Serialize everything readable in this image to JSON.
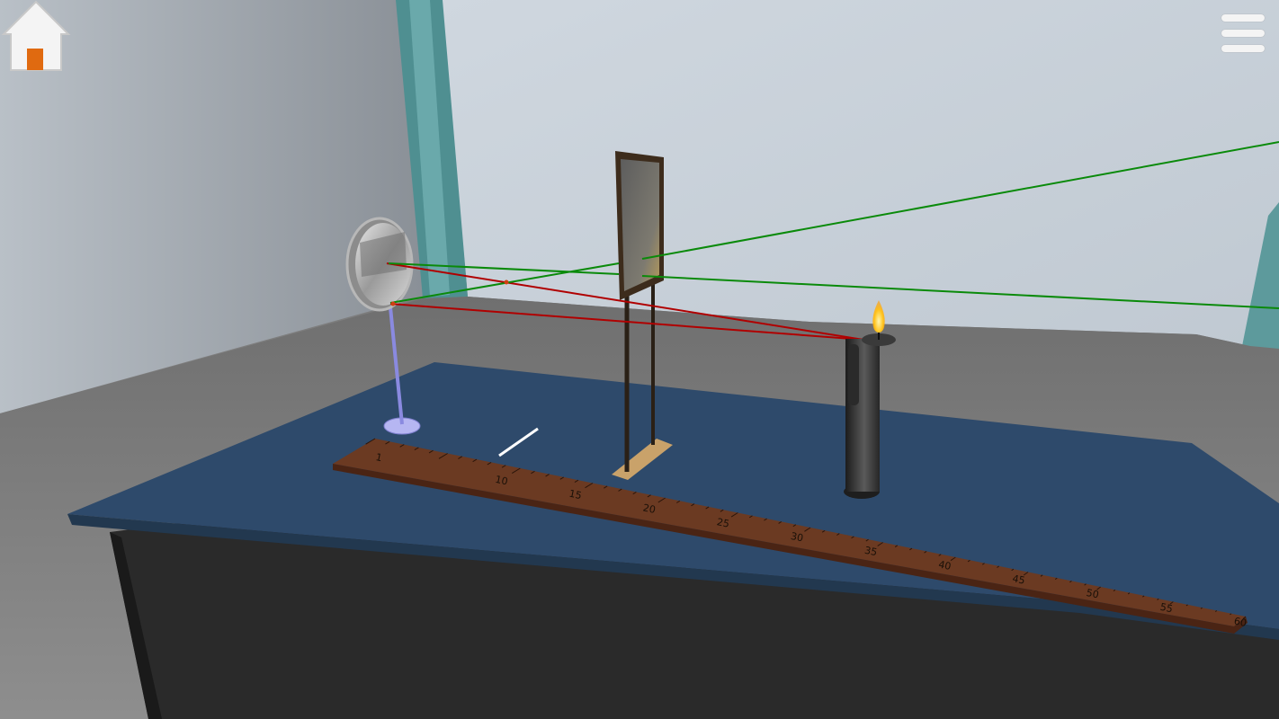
{
  "toolbar": {
    "home_icon": "home-icon",
    "menu_icon": "hamburger-menu-icon"
  },
  "ruler": {
    "tick_labels": [
      "1",
      "10",
      "15",
      "20",
      "25",
      "30",
      "35",
      "40",
      "45",
      "50",
      "55",
      "60"
    ]
  },
  "labels": {
    "object_marker": "",
    "screen_marker": ""
  },
  "colors": {
    "wall_left": "#9aa0a6",
    "wall_back": "#c7d0d8",
    "floor": "#7a7a7a",
    "table_top": "#2e4a6b",
    "ruler": "#6b3a22",
    "ray_red": "#b00000",
    "ray_green": "#0a8a0a",
    "mirror_stand": "#8080e0",
    "home_door": "#e06a10"
  }
}
